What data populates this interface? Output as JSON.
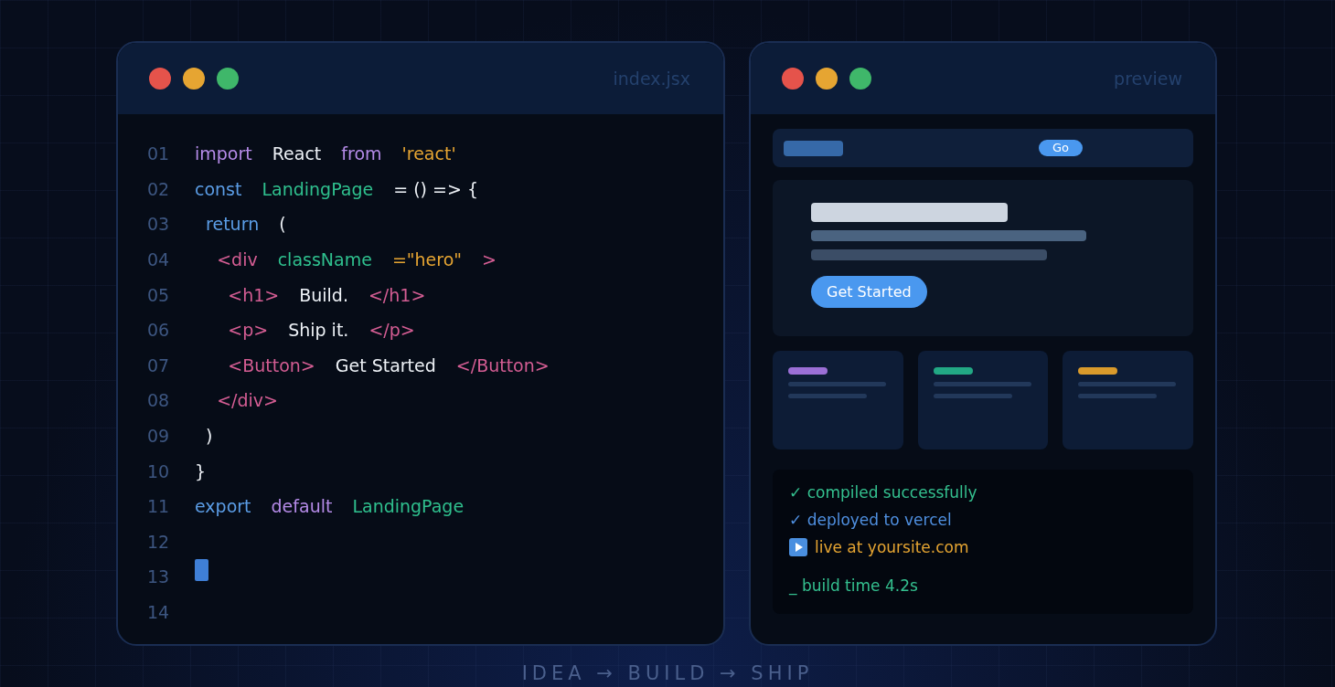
{
  "editor": {
    "title": "index.jsx",
    "lines": [
      {
        "number": "01",
        "tokens": [
          {
            "text": "import",
            "kind": "keyword"
          },
          {
            "text": "React",
            "kind": "plain"
          },
          {
            "text": "from",
            "kind": "keyword"
          },
          {
            "text": "'react'",
            "kind": "string"
          }
        ]
      },
      {
        "number": "02",
        "tokens": [
          {
            "text": "const",
            "kind": "decl"
          },
          {
            "text": "LandingPage",
            "kind": "name"
          },
          {
            "text": "= () => {",
            "kind": "plain"
          }
        ]
      },
      {
        "number": "03",
        "tokens": [
          {
            "text": "  return",
            "kind": "decl"
          },
          {
            "text": "(",
            "kind": "plain"
          }
        ]
      },
      {
        "number": "04",
        "tokens": [
          {
            "text": "    <div",
            "kind": "tag"
          },
          {
            "text": "className",
            "kind": "name"
          },
          {
            "text": "=\"hero\"",
            "kind": "string"
          },
          {
            "text": ">",
            "kind": "tag"
          }
        ]
      },
      {
        "number": "05",
        "tokens": [
          {
            "text": "      <h1>",
            "kind": "tag"
          },
          {
            "text": "Build.",
            "kind": "plain"
          },
          {
            "text": "</h1>",
            "kind": "tag"
          }
        ]
      },
      {
        "number": "06",
        "tokens": [
          {
            "text": "      <p>",
            "kind": "tag"
          },
          {
            "text": "Ship it.",
            "kind": "plain"
          },
          {
            "text": "</p>",
            "kind": "tag"
          }
        ]
      },
      {
        "number": "07",
        "tokens": [
          {
            "text": "      <Button>",
            "kind": "tag"
          },
          {
            "text": "Get Started",
            "kind": "plain"
          },
          {
            "text": "</Button>",
            "kind": "tag"
          }
        ]
      },
      {
        "number": "08",
        "tokens": [
          {
            "text": "    </div>",
            "kind": "tag"
          }
        ]
      },
      {
        "number": "09",
        "tokens": [
          {
            "text": "  )",
            "kind": "plain"
          }
        ]
      },
      {
        "number": "10",
        "tokens": [
          {
            "text": "}",
            "kind": "plain"
          }
        ]
      },
      {
        "number": "11",
        "tokens": [
          {
            "text": "export",
            "kind": "decl"
          },
          {
            "text": "default",
            "kind": "keyword"
          },
          {
            "text": "LandingPage",
            "kind": "name"
          }
        ]
      },
      {
        "number": "12",
        "cursor": false
      },
      {
        "number": "13",
        "cursor": true
      },
      {
        "number": "14",
        "cursor": false
      }
    ]
  },
  "preview": {
    "title": "preview",
    "nav_button": "Go",
    "hero_button": "Get Started",
    "cards": [
      {
        "color": "#9b6fd6"
      },
      {
        "color": "#22a884"
      },
      {
        "color": "#d99a2b"
      }
    ],
    "log": [
      {
        "kind": "text",
        "text": "✓ compiled successfully",
        "color": "#34c08f"
      },
      {
        "kind": "text",
        "text": "✓ deployed to vercel",
        "color": "#4f8fe0"
      },
      {
        "kind": "play",
        "text": "live at yoursite.com",
        "color": "#e6a532"
      },
      {
        "kind": "spaced",
        "text": "_ build time 4.2s",
        "color": "#34c08f"
      }
    ]
  },
  "footer": "IDEA → BUILD → SHIP"
}
